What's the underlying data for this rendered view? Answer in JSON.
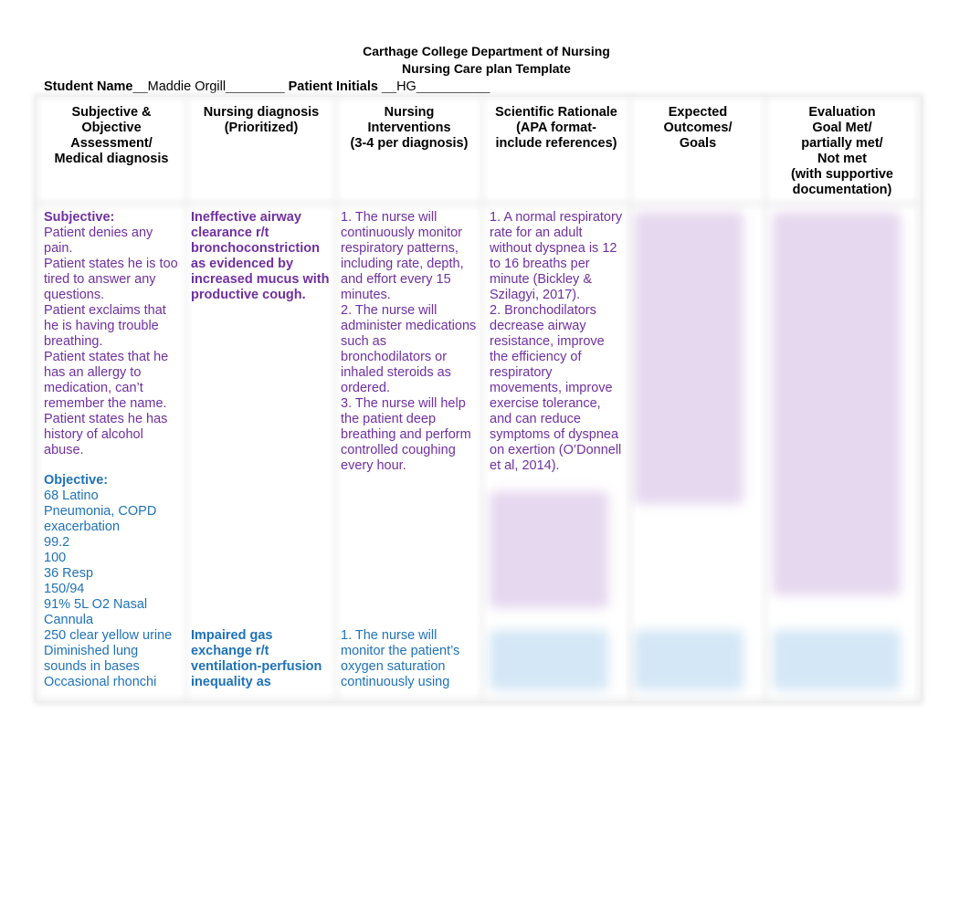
{
  "header": {
    "institution": "Carthage College Department of Nursing",
    "template_title": "Nursing Care plan Template",
    "student_name_label": "Student Name",
    "student_name_value": "__Maddie Orgill________",
    "patient_initials_label": "Patient Initials",
    "patient_initials_value": "__HG__________"
  },
  "table": {
    "columns": [
      {
        "label": "Subjective &\nObjective\nAssessment/\nMedical diagnosis"
      },
      {
        "label": "Nursing diagnosis\n(Prioritized)"
      },
      {
        "label": "Nursing\nInterventions\n(3-4 per diagnosis)"
      },
      {
        "label": "Scientific Rationale\n(APA format-\ninclude references)"
      },
      {
        "label": "Expected\nOutcomes/\nGoals"
      },
      {
        "label": "Evaluation\nGoal Met/\npartially met/\nNot met\n(with supportive\ndocumentation)"
      }
    ],
    "assessment": {
      "subjective_heading": "Subjective:",
      "subjective_items": [
        "Patient denies any pain.",
        "Patient states he is too tired to answer any questions.",
        "Patient exclaims that he is having trouble breathing.",
        "Patient states that he has an allergy to medication, can’t remember the name.",
        "Patient states he has history of alcohol abuse."
      ],
      "objective_heading": "Objective:",
      "objective_items": [
        "68 Latino",
        "Pneumonia, COPD exacerbation",
        "99.2",
        "100",
        "36 Resp",
        "150/94",
        "91% 5L O2 Nasal Cannula",
        "250 clear yellow urine",
        "Diminished lung sounds in bases",
        "Occasional rhonchi"
      ]
    },
    "diagnosis_1": {
      "text": "Ineffective airway clearance r/t bronchoconstriction as evidenced by increased mucus with productive cough.",
      "interventions": [
        "1. The nurse will continuously monitor respiratory patterns, including rate, depth, and effort every 15 minutes.",
        "2. The nurse will administer medications such as bronchodilators or inhaled steroids as ordered.",
        "3. The nurse will help the patient deep breathing and perform controlled coughing every hour."
      ],
      "rationales": [
        "1. A normal respiratory rate for an adult without dyspnea is 12 to 16 breaths per minute (Bickley & Szilagyi, 2017).",
        "2. Bronchodilators decrease airway resistance, improve the efficiency of respiratory movements, improve exercise tolerance, and can reduce symptoms of dyspnea on exertion (O’Donnell et al, 2014)."
      ]
    },
    "diagnosis_2": {
      "text": "Impaired gas exchange r/t ventilation-perfusion inequality as",
      "interventions": [
        "1. The nurse will monitor the patient’s oxygen saturation continuously using"
      ]
    },
    "colors": {
      "diagnosis_1": "#7030a0",
      "diagnosis_2": "#1f72b8"
    }
  }
}
